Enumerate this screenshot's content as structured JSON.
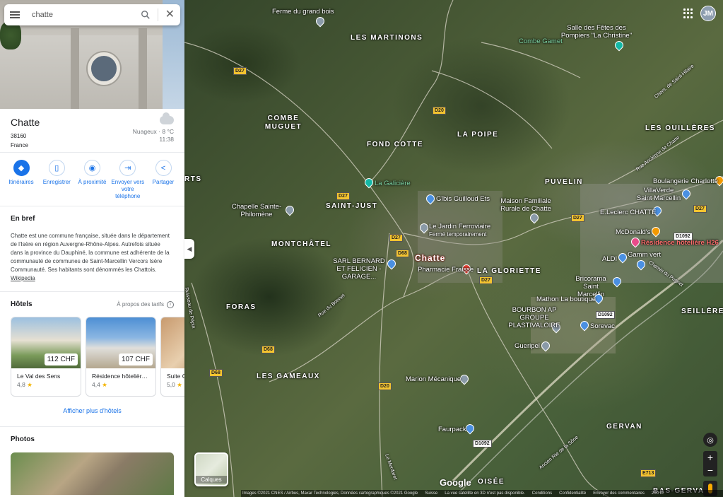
{
  "search": {
    "value": "chatte"
  },
  "place": {
    "title": "Chatte",
    "postcode": "38160",
    "country": "France",
    "weather": "Nuageux · 8 °C",
    "time": "11:38"
  },
  "actions": [
    {
      "label": "Itinéraires",
      "icon": "directions-icon"
    },
    {
      "label": "Enregistrer",
      "icon": "bookmark-icon"
    },
    {
      "label": "À proximité",
      "icon": "nearby-icon"
    },
    {
      "label": "Envoyer vers votre téléphone",
      "icon": "send-to-phone-icon"
    },
    {
      "label": "Partager",
      "icon": "share-icon"
    }
  ],
  "bref": {
    "title": "En bref",
    "text": "Chatte est une commune française, située dans le département de l'Isère en région Auvergne-Rhône-Alpes. Autrefois située dans la province du Dauphiné, la commune est adhérente de la communauté de communes de Saint-Marcellin Vercors Isère Communauté. Ses habitants sont dénommés les Chattois.",
    "link": "Wikipedia"
  },
  "hotels": {
    "title": "Hôtels",
    "note": "À propos des tarifs",
    "items": [
      {
        "name": "Le Val des Sens",
        "price": "112 CHF",
        "rating": "4,8"
      },
      {
        "name": "Résidence hôtelièr…",
        "price": "107 CHF",
        "rating": "4,4"
      },
      {
        "name": "Suite C",
        "price": "",
        "rating": "5,0"
      }
    ],
    "more": "Afficher plus d'hôtels"
  },
  "photos": {
    "title": "Photos"
  },
  "map": {
    "places": [
      {
        "text": "LES MARTINONS"
      },
      {
        "text": "COMBE MUGUET"
      },
      {
        "text": "FOND COTTE"
      },
      {
        "text": "LA POIPE"
      },
      {
        "text": "SAINT-JUST"
      },
      {
        "text": "MONTCHÂTEL"
      },
      {
        "text": "LA GLORIETTE"
      },
      {
        "text": "PUVELIN"
      },
      {
        "text": "LES OUILLÈRES"
      },
      {
        "text": "FORAS"
      },
      {
        "text": "LES GAMEAUX"
      },
      {
        "text": "GERVAN"
      },
      {
        "text": "SEILLÈRE"
      },
      {
        "text": "RTS"
      },
      {
        "text": "OISÉE"
      },
      {
        "text": "BAS-GERVAN"
      }
    ],
    "town": "Chatte",
    "pois": [
      {
        "text": "Ferme du grand bois"
      },
      {
        "text": "Salle des Fêtes des Pompiers \"La Christine\""
      },
      {
        "text": "Combe Gamet"
      },
      {
        "text": "La Galicière"
      },
      {
        "text": "Gîbis Guilloud Ets"
      },
      {
        "text": "Chapelle Sainte-Philomène"
      },
      {
        "text": "Le Jardin Ferroviaire"
      },
      {
        "text": "Fermé temporairement"
      },
      {
        "text": "SARL BERNARD ET FELICIEN - GARAGE..."
      },
      {
        "text": "Pharmacie Fraisse"
      },
      {
        "text": "Maison Familiale Rurale de Chatte"
      },
      {
        "text": "Boulangerie Charlotte"
      },
      {
        "text": "VillaVerde Saint Marcellin"
      },
      {
        "text": "E.Leclerc CHATTE"
      },
      {
        "text": "McDonald's"
      },
      {
        "text": "Résidence hôtelière H26"
      },
      {
        "text": "Gamm vert"
      },
      {
        "text": "ALDI"
      },
      {
        "text": "Bricorama Saint Marcellin"
      },
      {
        "text": "Mathon La boutique"
      },
      {
        "text": "BOURBON AP GROUPE PLASTIVALOIRE"
      },
      {
        "text": "Sorevac"
      },
      {
        "text": "Gueripel"
      },
      {
        "text": "Marion Mécanique"
      },
      {
        "text": "Faurpack"
      }
    ],
    "roads": [
      "D27",
      "D20",
      "D27",
      "D27",
      "D68",
      "D27",
      "D68",
      "D68",
      "D20",
      "D27",
      "D1092",
      "D1092",
      "D1092",
      "E713",
      "D27"
    ],
    "street_names": [
      "Rue Ancienne de Chatte",
      "Chemin du Pugnet",
      "Ancien Rte de la Sône",
      "Ruisseau de Pépin",
      "Rue du Bonnet",
      "Le Merdaret",
      "Chem. de Saint-Hilaire"
    ],
    "layers_label": "Calques",
    "google": "Google",
    "user_initials": "JM",
    "footer": [
      "Images ©2021 CNES / Airbus, Maxar Technologies, Données cartographiques ©2021 Google",
      "Suisse",
      "La vue satellite en 3D n'est pas disponible.",
      "Conditions",
      "Confidentialité",
      "Envoyer des commentaires",
      "200 m"
    ]
  }
}
